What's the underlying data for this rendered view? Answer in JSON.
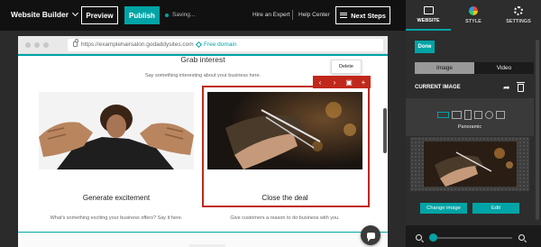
{
  "topbar": {
    "brand": "Website Builder",
    "preview_label": "Preview",
    "publish_label": "Publish",
    "status": "Saving...",
    "hire_expert": "Hire an Expert",
    "help_center": "Help Center",
    "next_steps": "Next Steps"
  },
  "browser": {
    "url": "https://examplehairsalon.godaddysites.com",
    "free_domain": "Free domain"
  },
  "site": {
    "section_title": "Grab interest",
    "section_subtitle": "Say something interesting about your business here.",
    "columns": [
      {
        "title": "Generate excitement",
        "text": "What's something exciting your business offers? Say it here."
      },
      {
        "title": "Close the deal",
        "text": "Give customers a reason to do business with you."
      }
    ],
    "tooltip": "Delete"
  },
  "panel": {
    "tabs": [
      {
        "label": "WEBSITE",
        "icon": "monitor-icon",
        "active": true
      },
      {
        "label": "STYLE",
        "icon": "palette-icon",
        "active": false
      },
      {
        "label": "SETTINGS",
        "icon": "gear-icon",
        "active": false
      }
    ],
    "done_label": "Done",
    "segments": [
      {
        "label": "Image",
        "selected": true
      },
      {
        "label": "Video",
        "selected": false
      }
    ],
    "current_image_label": "CURRENT IMAGE",
    "selected_shape": "Panoramic",
    "change_image_label": "Change image",
    "edit_label": "Edit",
    "zoom_level": 0.04
  },
  "colors": {
    "accent": "#00a4a6",
    "selection": "#c0281b",
    "dark": "#111111"
  }
}
